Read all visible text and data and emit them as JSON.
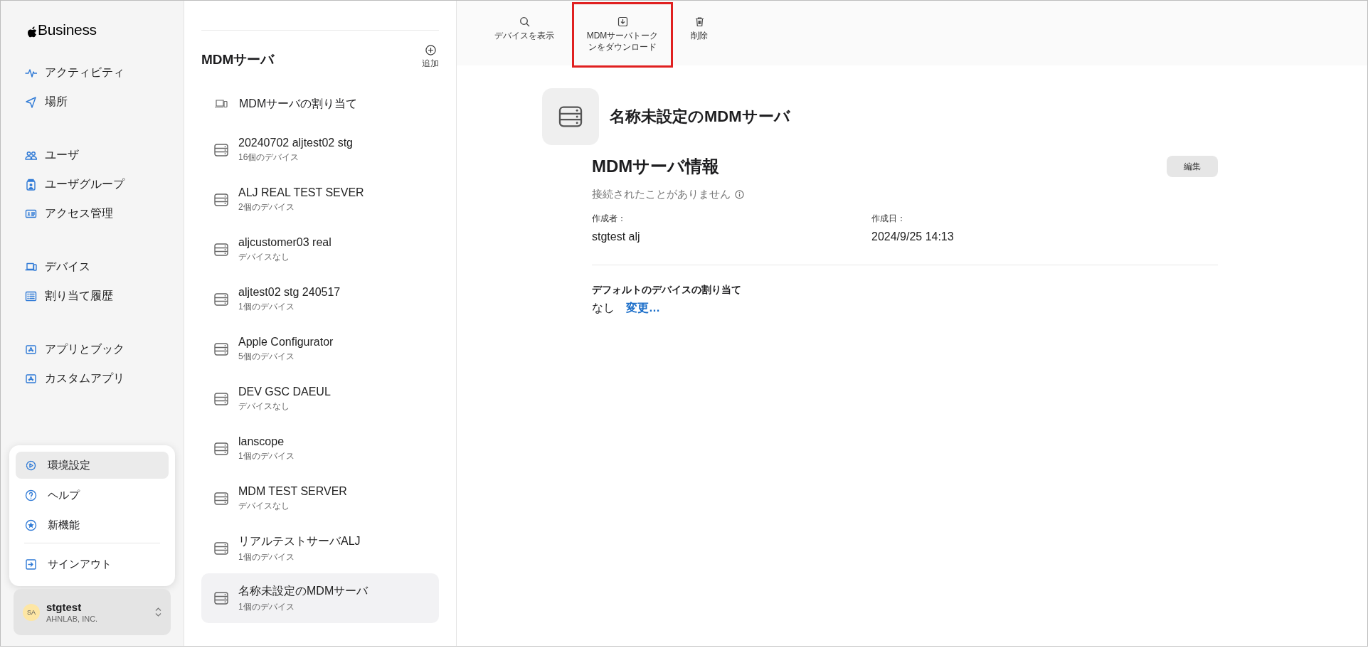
{
  "logo": {
    "text": "Business"
  },
  "nav_groups": [
    [
      {
        "label": "アクティビティ"
      },
      {
        "label": "場所"
      }
    ],
    [
      {
        "label": "ユーザ"
      },
      {
        "label": "ユーザグループ"
      },
      {
        "label": "アクセス管理"
      }
    ],
    [
      {
        "label": "デバイス"
      },
      {
        "label": "割り当て履歴"
      }
    ],
    [
      {
        "label": "アプリとブック"
      },
      {
        "label": "カスタムアプリ"
      }
    ]
  ],
  "account_menu": {
    "items": [
      {
        "label": "環境設定",
        "selected": true
      },
      {
        "label": "ヘルプ",
        "selected": false
      },
      {
        "label": "新機能",
        "selected": false
      },
      {
        "label": "サインアウト",
        "selected": false
      }
    ]
  },
  "account": {
    "initials": "SA",
    "name": "stgtest",
    "org": "AHNLAB, INC."
  },
  "server_list": {
    "title": "MDMサーバ",
    "add_label": "追加",
    "assign_label": "MDMサーバの割り当て",
    "items": [
      {
        "name": "20240702 aljtest02 stg",
        "devices": "16個のデバイス",
        "selected": false
      },
      {
        "name": "ALJ REAL TEST SEVER",
        "devices": "2個のデバイス",
        "selected": false
      },
      {
        "name": "aljcustomer03 real",
        "devices": "デバイスなし",
        "selected": false
      },
      {
        "name": "aljtest02 stg 240517",
        "devices": "1個のデバイス",
        "selected": false
      },
      {
        "name": "Apple Configurator",
        "devices": "5個のデバイス",
        "selected": false
      },
      {
        "name": "DEV GSC DAEUL",
        "devices": "デバイスなし",
        "selected": false
      },
      {
        "name": "lanscope",
        "devices": "1個のデバイス",
        "selected": false
      },
      {
        "name": "MDM TEST SERVER",
        "devices": "デバイスなし",
        "selected": false
      },
      {
        "name": "リアルテストサーバALJ",
        "devices": "1個のデバイス",
        "selected": false
      },
      {
        "name": "名称未設定のMDMサーバ",
        "devices": "1個のデバイス",
        "selected": true
      }
    ]
  },
  "toolbar": [
    {
      "label": "デバイスを表示",
      "highlighted": false
    },
    {
      "label": "MDMサーバトークンをダウンロード",
      "highlighted": true
    },
    {
      "label": "削除",
      "highlighted": false
    }
  ],
  "detail": {
    "title": "名称未設定のMDMサーバ",
    "section_title": "MDMサーバ情報",
    "edit_label": "編集",
    "status": "接続されたことがありません",
    "fields": [
      {
        "label": "作成者：",
        "value": "stgtest alj"
      },
      {
        "label": "作成日：",
        "value": "2024/9/25 14:13"
      }
    ],
    "default_assignment": {
      "label": "デフォルトのデバイスの割り当て",
      "value": "なし",
      "change_link": "変更…"
    }
  }
}
